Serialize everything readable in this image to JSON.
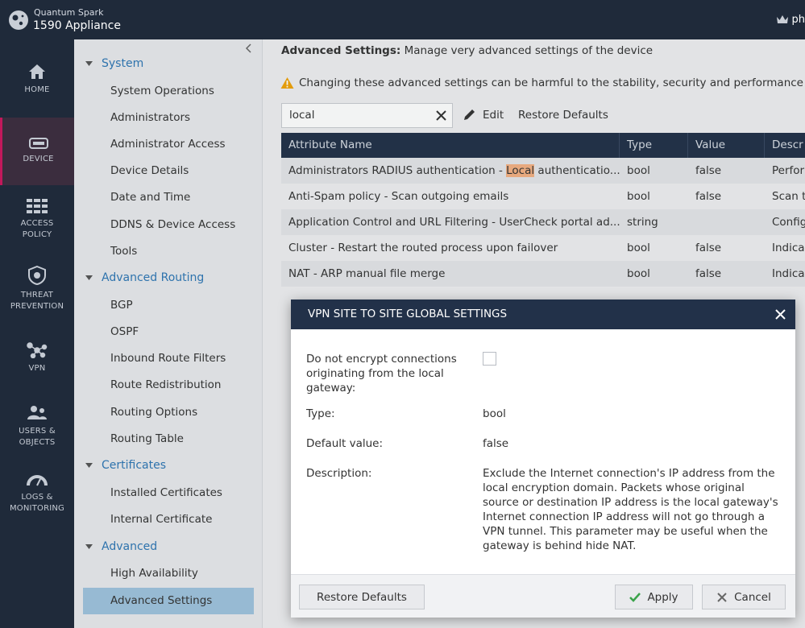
{
  "brand": {
    "product_sub": "Quantum Spark",
    "product_main": "1590 Appliance"
  },
  "user": {
    "name": "ph"
  },
  "nav": [
    {
      "label": "HOME"
    },
    {
      "label": "DEVICE"
    },
    {
      "label": "ACCESS\nPOLICY"
    },
    {
      "label": "THREAT\nPREVENTION"
    },
    {
      "label": "VPN"
    },
    {
      "label": "USERS &\nOBJECTS"
    },
    {
      "label": "LOGS &\nMONITORING"
    }
  ],
  "sidebar": {
    "system": {
      "title": "System",
      "items": [
        "System Operations",
        "Administrators",
        "Administrator Access",
        "Device Details",
        "Date and Time",
        "DDNS & Device Access",
        "Tools"
      ]
    },
    "routing": {
      "title": "Advanced Routing",
      "items": [
        "BGP",
        "OSPF",
        "Inbound Route Filters",
        "Route Redistribution",
        "Routing Options",
        "Routing Table"
      ]
    },
    "certs": {
      "title": "Certificates",
      "items": [
        "Installed Certificates",
        "Internal Certificate"
      ]
    },
    "advanced": {
      "title": "Advanced",
      "items": [
        "High Availability",
        "Advanced Settings"
      ]
    }
  },
  "main": {
    "title_bold": "Advanced Settings:",
    "title_rest": " Manage very advanced settings of the device",
    "warning": "Changing these advanced settings can be harmful to the stability, security and performance of the",
    "search_value": "local",
    "edit_label": "Edit",
    "restore_label": "Restore Defaults"
  },
  "table": {
    "headers": [
      "Attribute Name",
      "Type",
      "Value",
      "Descr"
    ],
    "rows": [
      {
        "pre": "Administrators RADIUS authentication - ",
        "hl": "Local",
        "post": " authenticatio...",
        "type": "bool",
        "value": "false",
        "desc": "Perfor"
      },
      {
        "pre": "Anti-Spam policy - Scan outgoing emails",
        "hl": "",
        "post": "",
        "type": "bool",
        "value": "false",
        "desc": "Scan t"
      },
      {
        "pre": "Application Control and URL Filtering - UserCheck portal ad...",
        "hl": "",
        "post": "",
        "type": "string",
        "value": "",
        "desc": "Config"
      },
      {
        "pre": "Cluster - Restart the routed process upon failover",
        "hl": "",
        "post": "",
        "type": "bool",
        "value": "false",
        "desc": "Indica"
      },
      {
        "pre": "NAT - ARP manual file merge",
        "hl": "",
        "post": "",
        "type": "bool",
        "value": "false",
        "desc": "Indica"
      }
    ]
  },
  "modal": {
    "title": "VPN SITE TO SITE GLOBAL SETTINGS",
    "field_label": "Do not encrypt connections originating from the local gateway:",
    "type_label": "Type:",
    "type_value": "bool",
    "default_label": "Default value:",
    "default_value": "false",
    "desc_label": "Description:",
    "desc_value": "Exclude the Internet connection's IP address from the local encryption domain. Packets whose original source or destination IP address is the local gateway's Internet connection IP address will not go through a VPN tunnel. This parameter may be useful when the gateway is behind hide NAT.",
    "restore_label": "Restore Defaults",
    "apply_label": "Apply",
    "cancel_label": "Cancel"
  },
  "colors": {
    "navy": "#1f2a3a",
    "header_navy": "#223149",
    "accent_blue": "#2f77b5",
    "active_pink": "#c2185b",
    "highlight": "#f4b183",
    "check_green": "#3aa34a"
  },
  "icons": [
    "logo-icon",
    "crown-icon",
    "home-icon",
    "device-icon",
    "access-policy-icon",
    "threat-prevention-icon",
    "vpn-icon",
    "users-objects-icon",
    "logs-monitoring-icon",
    "collapse-chevron-icon",
    "caret-down-icon",
    "warning-icon",
    "clear-icon",
    "pencil-icon",
    "close-icon",
    "check-icon",
    "x-icon"
  ]
}
